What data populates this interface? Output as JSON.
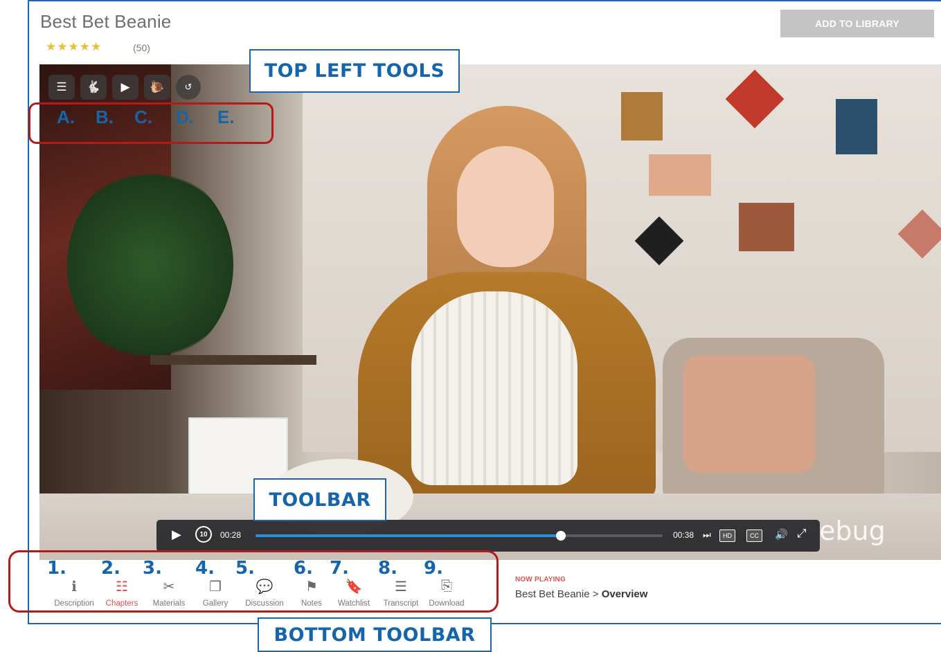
{
  "course": {
    "title": "Best Bet Beanie",
    "stars": "★★★★★",
    "rating_count": "(50)",
    "add_button": "ADD TO LIBRARY"
  },
  "annotations": {
    "top_left_tools": "TOP LEFT TOOLS",
    "toolbar": "TOOLBAR",
    "bottom_toolbar": "BOTTOM TOOLBAR",
    "letters": [
      "A.",
      "B.",
      "C.",
      "D.",
      "E."
    ]
  },
  "top_tools": [
    {
      "icon": "list-icon",
      "glyph": "☰"
    },
    {
      "icon": "rabbit-icon",
      "glyph": "🐇"
    },
    {
      "icon": "play-icon",
      "glyph": "▶"
    },
    {
      "icon": "snail-icon",
      "glyph": "🐌"
    },
    {
      "icon": "replay-icon",
      "glyph": "↺"
    }
  ],
  "player": {
    "current_time": "00:28",
    "end_time": "00:38",
    "progress": 0.75,
    "hd_label": "HD",
    "cc_label": "CC",
    "rewind_label": "10",
    "watermark": "ebug"
  },
  "bottom_tools": [
    {
      "num": "1.",
      "label": "Description",
      "icon": "info-icon",
      "glyph": "ℹ",
      "active": false
    },
    {
      "num": "2.",
      "label": "Chapters",
      "icon": "chapters-icon",
      "glyph": "☷",
      "active": true
    },
    {
      "num": "3.",
      "label": "Materials",
      "icon": "yarn-icon",
      "glyph": "✂",
      "active": false
    },
    {
      "num": "4.",
      "label": "Gallery",
      "icon": "gallery-icon",
      "glyph": "❐",
      "active": false
    },
    {
      "num": "5.",
      "label": "Discussion",
      "icon": "discussion-icon",
      "glyph": "💬",
      "active": false
    },
    {
      "num": "6.",
      "label": "Notes",
      "icon": "flag-icon",
      "glyph": "⚑",
      "active": false
    },
    {
      "num": "7.",
      "label": "Watchlist",
      "icon": "bookmark-icon",
      "glyph": "🔖",
      "active": false
    },
    {
      "num": "8.",
      "label": "Transcript",
      "icon": "transcript-icon",
      "glyph": "☰",
      "active": false
    },
    {
      "num": "9.",
      "label": "Download",
      "icon": "download-icon",
      "glyph": "⎘",
      "active": false
    }
  ],
  "now_playing": {
    "label": "NOW PLAYING",
    "course": "Best Bet Beanie",
    "separator": " > ",
    "chapter": "Overview"
  },
  "colors": {
    "annotation_blue": "#1565ad",
    "highlight_red": "#b51919",
    "progress_blue": "#2b8fd6",
    "active_red": "#e64a4a",
    "star_gold": "#e9c02d"
  }
}
